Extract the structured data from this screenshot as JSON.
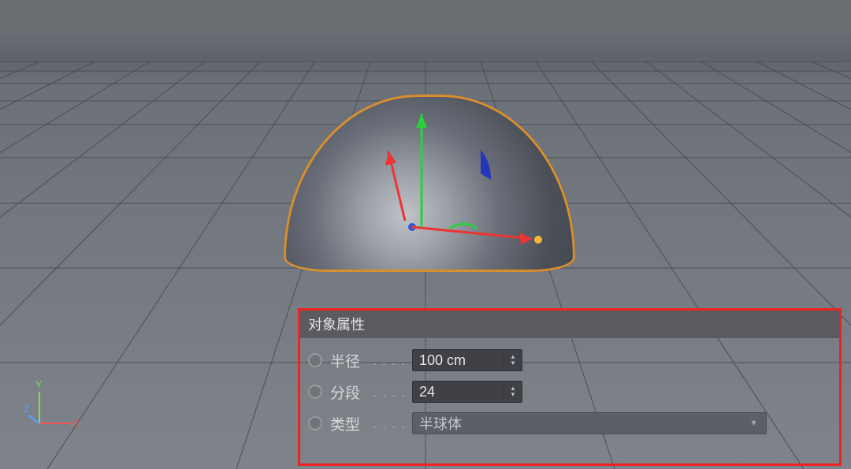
{
  "panel": {
    "title": "对象属性",
    "radius": {
      "label": "半径",
      "value": "100 cm"
    },
    "segments": {
      "label": "分段",
      "value": "24"
    },
    "type": {
      "label": "类型",
      "value": "半球体"
    }
  },
  "axes": {
    "x": "X",
    "y": "Y",
    "z": "Z"
  }
}
